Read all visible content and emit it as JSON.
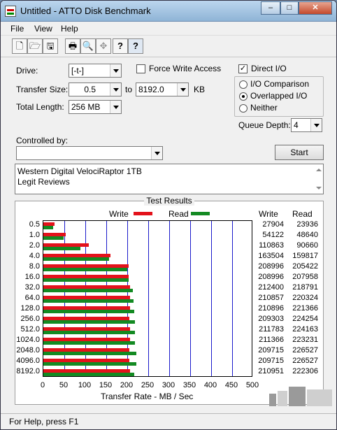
{
  "window": {
    "title": "Untitled - ATTO Disk Benchmark",
    "min": "–",
    "max": "□",
    "close": "✕"
  },
  "menu": [
    "File",
    "View",
    "Help"
  ],
  "toolbar": {
    "new": "🗋",
    "open": "🗁",
    "save": "🖫",
    "print": "🖶",
    "preview": "🔍",
    "move": "✥",
    "help": "?",
    "context_help": "?"
  },
  "form": {
    "drive_label": "Drive:",
    "drive_value": "[-t-]",
    "transfer_size_label": "Transfer Size:",
    "transfer_from": "0.5",
    "to_label": "to",
    "transfer_to": "8192.0",
    "unit": "KB",
    "total_length_label": "Total Length:",
    "total_length_value": "256 MB",
    "force_write_label": "Force Write Access",
    "direct_io_label": "Direct I/O",
    "io_comparison_label": "I/O Comparison",
    "overlapped_io_label": "Overlapped I/O",
    "neither_label": "Neither",
    "queue_depth_label": "Queue Depth:",
    "queue_depth_value": "4",
    "controlled_by_label": "Controlled by:",
    "controlled_by_value": "",
    "start_label": "Start",
    "description_line1": "Western Digital VelociRaptor 1TB",
    "description_line2": "Legit Reviews"
  },
  "results": {
    "title": "Test Results",
    "legend_write": "Write",
    "legend_read": "Read",
    "col_write": "Write",
    "col_read": "Read"
  },
  "chart_data": {
    "type": "bar",
    "orientation": "horizontal",
    "categories": [
      "0.5",
      "1.0",
      "2.0",
      "4.0",
      "8.0",
      "16.0",
      "32.0",
      "64.0",
      "128.0",
      "256.0",
      "512.0",
      "1024.0",
      "2048.0",
      "4096.0",
      "8192.0"
    ],
    "series": [
      {
        "name": "Write",
        "color": "#e3121b",
        "values": [
          27904,
          54122,
          110863,
          163504,
          208996,
          208996,
          212400,
          210857,
          210896,
          209303,
          211783,
          211366,
          209715,
          209715,
          210951
        ]
      },
      {
        "name": "Read",
        "color": "#138a22",
        "values": [
          23936,
          48640,
          90660,
          159817,
          205422,
          207958,
          218791,
          220324,
          221366,
          224254,
          224163,
          223231,
          226527,
          226527,
          222306
        ]
      }
    ],
    "xlabel": "Transfer Rate - MB / Sec",
    "xlim": [
      0,
      500
    ],
    "xticks": [
      "0",
      "50",
      "100",
      "150",
      "200",
      "250",
      "300",
      "350",
      "400",
      "450",
      "500"
    ],
    "value_divisor_to_mb": 1024,
    "grid": true,
    "legend": "top"
  },
  "status": {
    "text": "For Help, press F1"
  },
  "colors": {
    "write": "#e3121b",
    "read": "#138a22",
    "grid": "#1a1acb"
  }
}
